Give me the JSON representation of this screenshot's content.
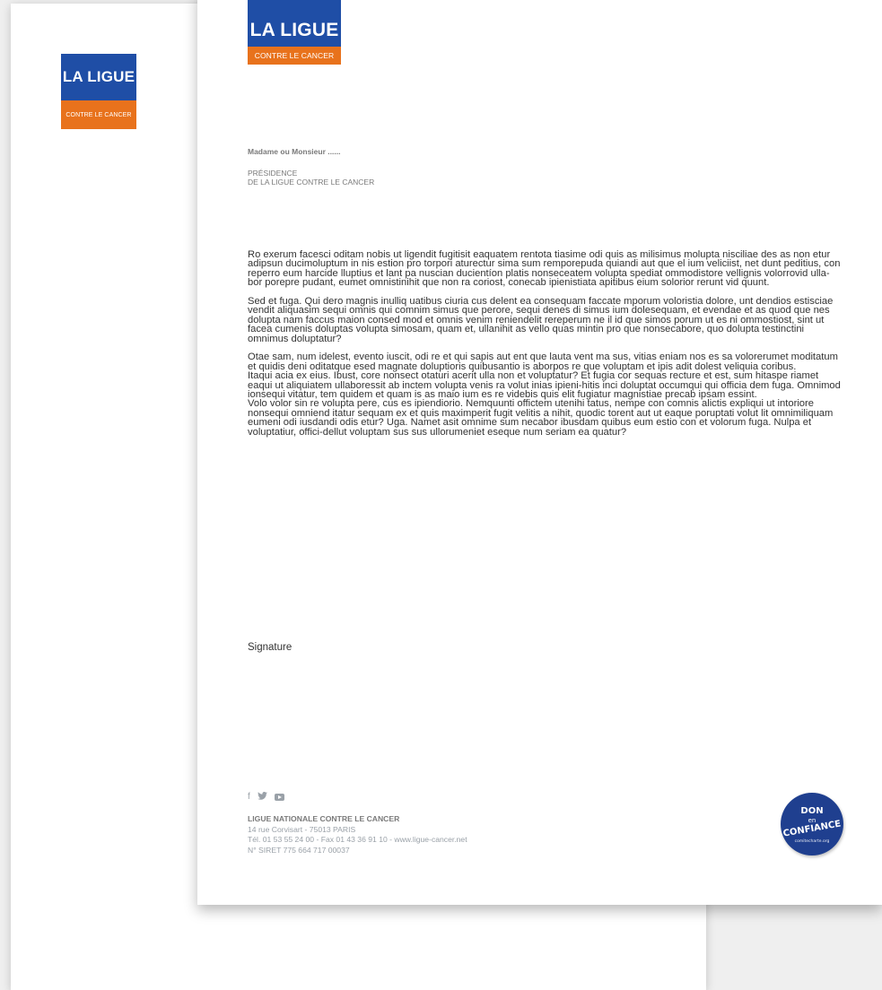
{
  "logo": {
    "title": "LA LIGUE",
    "subtitle": "CONTRE LE CANCER"
  },
  "letter": {
    "recipient": "Madame ou Monsieur ......",
    "sender_line1": "PRÉSIDENCE",
    "sender_line2": "DE LA LIGUE CONTRE LE CANCER",
    "paragraphs": [
      "Ro exerum facesci oditam nobis ut ligendit fugitisit eaquatem rentota tiasime odi quis as milisimus molupta nisciliae des as non etur adipsun ducimoluptum in nis estion pro torpori aturectur sima sum remporepuda quiandi aut que el ium veliciist, net dunt peditius, con reperro eum harcide lluptius et lant pa nuscian ducientíon platis nonseceatem volupta spediat ommodistore vellignis volorrovid ulla-bor porepre pudant, eumet omnistinihit que non ra coriost, conecab ipienistiata apitibus eium solorior rerunt vid quunt.",
      "Sed et fuga. Qui dero magnis inulliq uatibus ciuria cus delent ea consequam faccate mporum voloristia dolore, unt dendios estisciae vendit aliquasim sequi omnis qui comnim simus que perore, sequi denes di simus ium dolesequam, et evendae et as quod que nes dolupta nam faccus maion consed mod et omnis venim reniendelit rereperum ne il id que simos porum ut es ni ommostiost, sint ut facea cumenis doluptas volupta simosam, quam et, ullanihit as vello quas mintin pro que nonsecabore, quo dolupta testinctini omnimus doluptatur?",
      "Otae sam, num idelest, evento iuscit, odi re et qui sapis aut ent que lauta vent ma sus, vitias eniam nos es sa volorerumet moditatum et quidis deni oditatque esed magnate doluptioris quibusantio is aborpos re que voluptam et ipis adit dolest veliquia coribus.",
      "Itaqui acia ex eius. Ibust, core nonsect otaturi acerit ulla non et voluptatur? Et fugia cor sequas recture et est, sum hitaspe riamet eaqui ut aliquiatem ullaboressit ab inctem volupta venis ra volut inias ipieni-hitis inci doluptat occumqui qui officia dem fuga. Omnimod ionsequi vitatur, tem quidem et quam is as maio ium es re videbis quis elit fugiatur magnistiae precab ipsam essint.",
      "Volo volor sin re volupta pere, cus es ipiendiorio. Nemquunti offictem utenihi tatus, nempe con comnis alictis expliqui ut intoriore nonsequi omniend itatur sequam ex et quis maximperit fugit velitis a nihit, quodic torent aut ut eaque poruptati volut lit omnimiliquam eumeni odi iusdandi odis etur? Uga. Namet asit omnime sum necabor ibusdam quibus eum estio con et volorum fuga. Nulpa et voluptatiur, offici-dellut voluptam sus sus ullorumeniet eseque num seriam ea quatur?"
    ],
    "signature": "Signature"
  },
  "footer": {
    "org": "LIGUE NATIONALE CONTRE LE CANCER",
    "address": "14 rue Corvisart - 75013 PARIS",
    "contact": "Tél. 01 53 55 24 00 - Fax 01 43 36 91 10 - www.ligue-cancer.net",
    "siret": "N° SIRET 775 664 717 00037"
  },
  "badge": {
    "line1": "DON",
    "line2": "en",
    "line3": "CONFIANCE",
    "line4": "comitecharte.org"
  },
  "icons": [
    "facebook-icon",
    "twitter-icon",
    "youtube-icon"
  ],
  "colors": {
    "brand_blue": "#1f4ea6",
    "brand_orange": "#e8721c",
    "badge_blue": "#1f3f8f"
  }
}
